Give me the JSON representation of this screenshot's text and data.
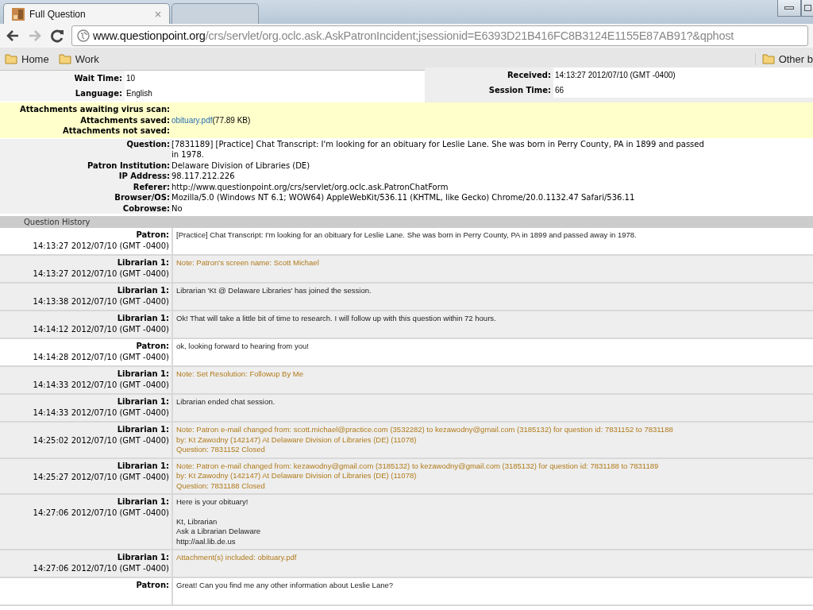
{
  "browser": {
    "tabs": [
      {
        "title": "Full Question",
        "selected": true
      },
      {
        "selected": false
      }
    ],
    "back_enabled": true,
    "forward_enabled": false,
    "url": {
      "host": "www.questionpoint.org",
      "path": "/crs/servlet/org.oclc.ask.AskPatronIncident;jsessionid=E6393D21B416FC8B3124E1155E87AB91?&qphost"
    },
    "bookmarks": [
      "Home",
      "Work"
    ],
    "other_bookmarks": "Other b"
  },
  "summary": {
    "left": [
      {
        "label": "Wait Time:",
        "value": "10"
      },
      {
        "label": "Language:",
        "value": "English"
      }
    ],
    "right": [
      {
        "label": "Received:",
        "value": "14:13:27 2012/07/10 (GMT -0400)"
      },
      {
        "label": "Session Time:",
        "value": "66"
      }
    ]
  },
  "attachments": [
    {
      "label": "Attachments awaiting virus scan:"
    },
    {
      "label": "Attachments saved:",
      "link": "obituary.pdf",
      "value": "(77.89 KB)"
    },
    {
      "label": "Attachments not saved:"
    }
  ],
  "details": [
    {
      "label": "Question:",
      "lines": [
        "[7831189] [Practice] Chat Transcript: I'm looking for an obituary for Leslie Lane. She was born in Perry County, PA in 1899 and passed",
        "in 1978."
      ]
    },
    {
      "label": "Patron Institution:",
      "lines": [
        "Delaware Division of Libraries (DE)"
      ]
    },
    {
      "label": "IP Address:",
      "lines": [
        "98.117.212.226"
      ]
    },
    {
      "label": "Referer:",
      "lines": [
        "http://www.questionpoint.org/crs/servlet/org.oclc.ask.PatronChatForm"
      ]
    },
    {
      "label": "Browser/OS:",
      "lines": [
        "Mozilla/5.0 (Windows NT 6.1; WOW64) AppleWebKit/536.11 (KHTML, like Gecko) Chrome/20.0.1132.47 Safari/536.11"
      ]
    },
    {
      "label": "Cobrowse:",
      "lines": [
        "No"
      ]
    }
  ],
  "history": {
    "title": "Question History",
    "entries": [
      {
        "kind": "patron",
        "speaker": "Patron:",
        "time": "14:13:27 2012/07/10 (GMT -0400)",
        "note": false,
        "paragraphs": [
          [
            "[Practice] Chat Transcript: I'm looking for an obituary for Leslie Lane. She was born in Perry County, PA in 1899 and passed away in 1978."
          ]
        ]
      },
      {
        "kind": "librarian",
        "speaker": "Librarian 1:",
        "time": "14:13:27 2012/07/10 (GMT -0400)",
        "note": true,
        "paragraphs": [
          [
            "Note: Patron's screen name: Scott Michael"
          ]
        ]
      },
      {
        "kind": "librarian",
        "speaker": "Librarian 1:",
        "time": "14:13:38 2012/07/10 (GMT -0400)",
        "note": false,
        "paragraphs": [
          [
            "Librarian 'Kt @ Delaware Libraries' has joined the session."
          ]
        ]
      },
      {
        "kind": "librarian",
        "speaker": "Librarian 1:",
        "time": "14:14:12 2012/07/10 (GMT -0400)",
        "note": false,
        "paragraphs": [
          [
            "Ok! That will take a little bit of time to research. I will follow up with this question within 72 hours."
          ]
        ]
      },
      {
        "kind": "patron",
        "speaker": "Patron:",
        "time": "14:14:28 2012/07/10 (GMT -0400)",
        "note": false,
        "paragraphs": [
          [
            "ok, looking forward to hearing from you!"
          ]
        ]
      },
      {
        "kind": "librarian",
        "speaker": "Librarian 1:",
        "time": "14:14:33 2012/07/10 (GMT -0400)",
        "note": true,
        "paragraphs": [
          [
            "Note: Set Resolution: Followup By Me"
          ]
        ]
      },
      {
        "kind": "librarian",
        "speaker": "Librarian 1:",
        "time": "14:14:33 2012/07/10 (GMT -0400)",
        "note": false,
        "paragraphs": [
          [
            "Librarian ended chat session."
          ]
        ]
      },
      {
        "kind": "librarian",
        "speaker": "Librarian 1:",
        "time": "14:25:02 2012/07/10 (GMT -0400)",
        "note": true,
        "paragraphs": [
          [
            "Note: Patron e-mail changed from: scott.michael@practice.com (3532282) to kezawodny@gmail.com (3185132) for question id: 7831152 to 7831188",
            "by: Kt Zawodny (142147) At Delaware Division of Libraries (DE) (11078)",
            "Question: 7831152 Closed"
          ]
        ]
      },
      {
        "kind": "librarian",
        "speaker": "Librarian 1:",
        "time": "14:25:27 2012/07/10 (GMT -0400)",
        "note": true,
        "paragraphs": [
          [
            "Note: Patron e-mail changed from: kezawodny@gmail.com (3185132) to kezawodny@gmail.com (3185132) for question id: 7831188 to 7831189",
            "by: Kt Zawodny (142147) At Delaware Division of Libraries (DE) (11078)",
            "Question: 7831188 Closed"
          ]
        ]
      },
      {
        "kind": "librarian",
        "speaker": "Librarian 1:",
        "time": "14:27:06 2012/07/10 (GMT -0400)",
        "note": false,
        "paragraphs": [
          [
            "Here is your obituary!"
          ],
          [
            "Kt, Librarian",
            "Ask a Librarian Delaware",
            "http://aal.lib.de.us"
          ]
        ]
      },
      {
        "kind": "librarian",
        "speaker": "Librarian 1:",
        "time": "14:27:06 2012/07/10 (GMT -0400)",
        "note": true,
        "paragraphs": [
          [
            "Attachment(s) included: obituary.pdf"
          ]
        ]
      },
      {
        "kind": "patron",
        "speaker": "Patron:",
        "note": false,
        "paragraphs": [
          [
            "Great! Can you find me any other information about Leslie Lane?"
          ]
        ]
      }
    ]
  }
}
